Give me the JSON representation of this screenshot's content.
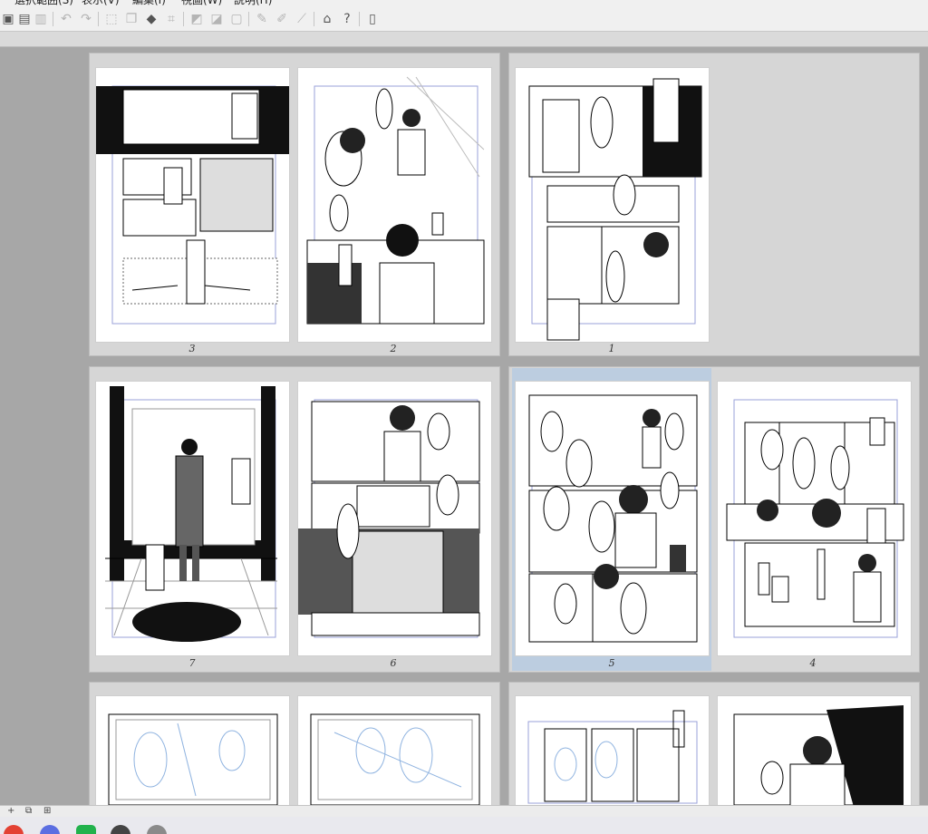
{
  "menubar": {
    "items": [
      "選択範囲(S)",
      "表示(V)",
      "編集(I)",
      "視圖(W)",
      "説明(H)"
    ]
  },
  "toolbar": {
    "icons": [
      "export-icon",
      "import-icon",
      "print-icon",
      "undo-icon",
      "redo-icon",
      "select-icon",
      "copy-icon",
      "fill-icon",
      "crop-icon",
      "ruler-icon",
      "gradient-icon",
      "frame-icon",
      "pen-icon",
      "pencil-icon",
      "brush-icon",
      "cap-icon",
      "help-icon",
      "tablet-icon"
    ]
  },
  "pages": [
    {
      "num": "3"
    },
    {
      "num": "2"
    },
    {
      "num": "1"
    },
    {
      "num": "7"
    },
    {
      "num": "6"
    },
    {
      "num": "5"
    },
    {
      "num": "4"
    }
  ],
  "selected_page": "5",
  "statusbar": {
    "icons": [
      "add-icon",
      "duplicate-icon",
      "properties-icon"
    ]
  },
  "taskbar": {
    "apps": [
      {
        "name": "chrome-icon",
        "color": "#e34133"
      },
      {
        "name": "browser-icon",
        "color": "#5b6ee1"
      },
      {
        "name": "line-icon",
        "color": "#22b24c"
      },
      {
        "name": "app-icon",
        "color": "#444444"
      },
      {
        "name": "app2-icon",
        "color": "#8a8a8a"
      }
    ]
  }
}
